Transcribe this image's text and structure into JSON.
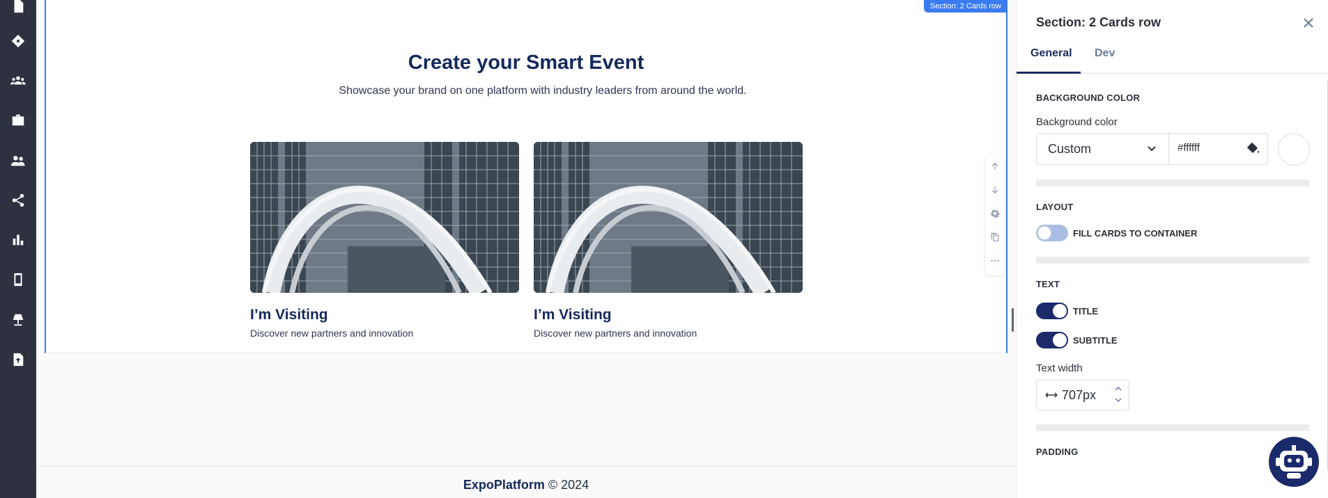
{
  "leftnav": {
    "icons": [
      "document-icon",
      "ticket-icon",
      "group-icon",
      "briefcase-icon",
      "people-icon",
      "share-icon",
      "bar-chart-icon",
      "mobile-icon",
      "lamp-icon",
      "file-upload-icon"
    ]
  },
  "canvas": {
    "section_tag": "Section: 2 Cards row",
    "title": "Create your Smart Event",
    "subtitle": "Showcase your brand on one platform with industry leaders from around the world.",
    "cards": [
      {
        "title": "I’m Visiting",
        "subtitle": "Discover new partners and innovation"
      },
      {
        "title": "I’m Visiting",
        "subtitle": "Discover new partners and innovation"
      }
    ],
    "toolbox": [
      "arrow-up-icon",
      "arrow-down-icon",
      "gear-icon",
      "copy-icon",
      "more-icon"
    ]
  },
  "footer": {
    "brand": "ExpoPlatform",
    "copyright": "© 2024"
  },
  "panel": {
    "title": "Section: 2 Cards row",
    "tabs": [
      {
        "label": "General",
        "active": true
      },
      {
        "label": "Dev",
        "active": false
      }
    ],
    "background": {
      "heading": "BACKGROUND COLOR",
      "label": "Background color",
      "select_value": "Custom",
      "hex_value": "#ffffff",
      "swatch_color": "#ffffff"
    },
    "layout": {
      "heading": "LAYOUT",
      "fill_cards_label": "FILL CARDS TO CONTAINER",
      "fill_cards_on": false
    },
    "text": {
      "heading": "TEXT",
      "title_label": "TITLE",
      "title_on": true,
      "subtitle_label": "SUBTITLE",
      "subtitle_on": true,
      "width_label": "Text width",
      "width_value": "707px"
    },
    "padding": {
      "heading": "PADDING"
    }
  },
  "colors": {
    "accent": "#3a7bf2",
    "navy": "#1b2a6b",
    "nav_bg": "#2e3140"
  }
}
